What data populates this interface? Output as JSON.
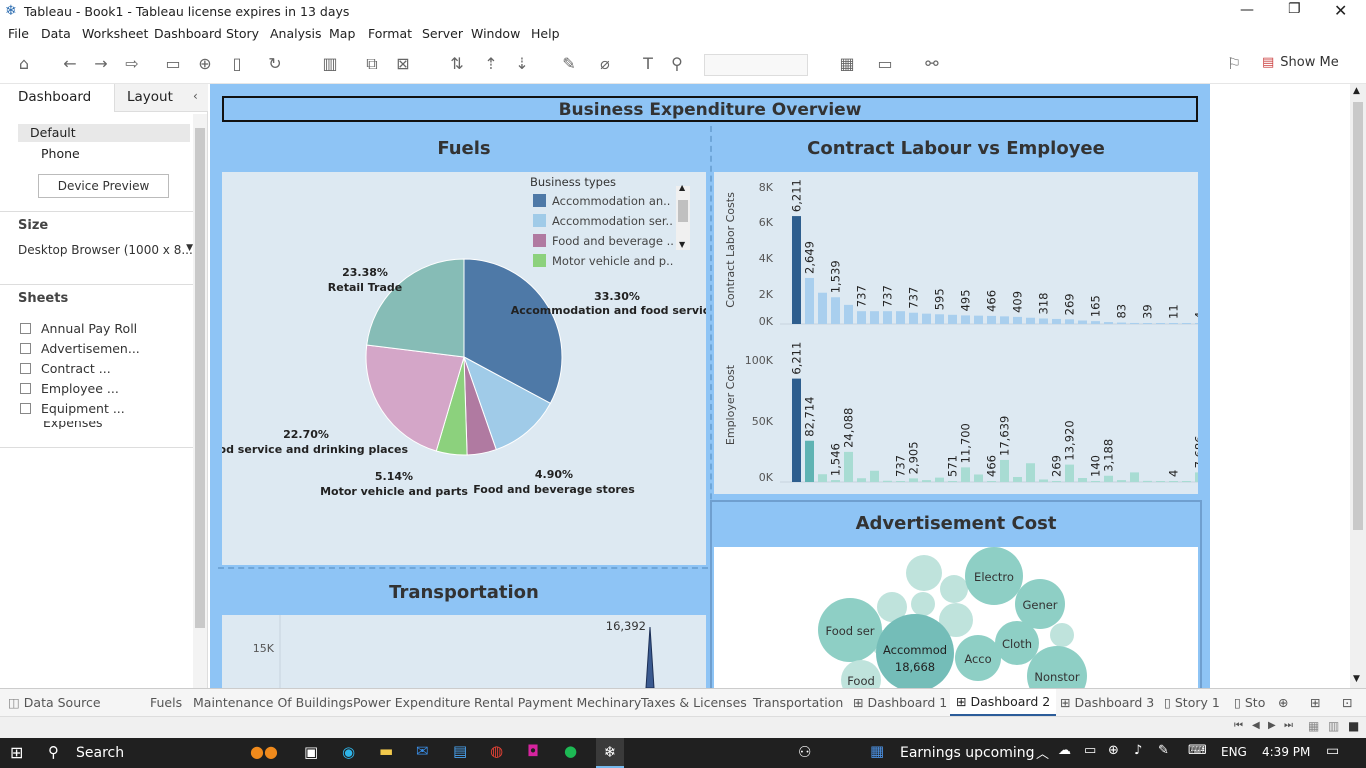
{
  "window": {
    "title": "Tableau - Book1 - Tableau license expires in 13 days"
  },
  "menu": [
    "File",
    "Data",
    "Worksheet",
    "Dashboard",
    "Story",
    "Analysis",
    "Map",
    "Format",
    "Server",
    "Window",
    "Help"
  ],
  "toolbar": {
    "show_me": "Show Me"
  },
  "left": {
    "tab_dashboard": "Dashboard",
    "tab_layout": "Layout",
    "device_default": "Default",
    "device_phone": "Phone",
    "device_preview": "Device Preview",
    "size_heading": "Size",
    "size_value": "Desktop Browser (1000 x 8...",
    "sheets_heading": "Sheets",
    "sheets": [
      "Annual Pay Roll",
      "Advertisemen...",
      "Contract ...",
      "Employee ...",
      "Equipment ...",
      "Expenses YoY"
    ]
  },
  "dashboard": {
    "title": "Business Expenditure Overview",
    "fuels": {
      "title": "Fuels",
      "legend_title": "Business types",
      "legend": [
        {
          "label": "Accommodation an..",
          "color": "#4e79a7"
        },
        {
          "label": "Accommodation ser..",
          "color": "#a0cbe8"
        },
        {
          "label": "Food and beverage ..",
          "color": "#b07aa1"
        },
        {
          "label": "Motor vehicle and p..",
          "color": "#8cd17d"
        }
      ],
      "slices": [
        {
          "pct": "33.30%",
          "label": "Accommodation and food services",
          "value": 33.3,
          "color": "#4e79a7"
        },
        {
          "pct": "",
          "label": "",
          "value": 12.0,
          "color": "#a0cbe8"
        },
        {
          "pct": "4.90%",
          "label": "Food and beverage stores",
          "value": 4.9,
          "color": "#b07aa1"
        },
        {
          "pct": "5.14%",
          "label": "Motor vehicle and parts",
          "value": 5.14,
          "color": "#8cd17d"
        },
        {
          "pct": "22.70%",
          "label": "Food service and drinking places",
          "value": 22.7,
          "color": "#d4a6c8"
        },
        {
          "pct": "23.38%",
          "label": "Retail Trade",
          "value": 23.38,
          "color": "#86bcb6"
        }
      ]
    },
    "contract": {
      "title": "Contract Labour vs Employee",
      "top_ylabel": "Contract Labor Costs",
      "top_ticks": [
        "8K",
        "6K",
        "4K",
        "2K",
        "0K"
      ],
      "top_values": [
        6211,
        2649,
        1800,
        1539,
        1100,
        737,
        737,
        737,
        737,
        650,
        595,
        560,
        530,
        495,
        480,
        466,
        440,
        409,
        360,
        318,
        290,
        269,
        200,
        165,
        110,
        83,
        60,
        39,
        25,
        11,
        8,
        4
      ],
      "top_labels": [
        [
          "6,211",
          0
        ],
        [
          "2,649",
          1
        ],
        [
          "1,539",
          3
        ],
        [
          "737",
          5
        ],
        [
          "737",
          7
        ],
        [
          "737",
          9
        ],
        [
          "595",
          11
        ],
        [
          "495",
          13
        ],
        [
          "466",
          15
        ],
        [
          "409",
          17
        ],
        [
          "318",
          19
        ],
        [
          "269",
          21
        ],
        [
          "165",
          23
        ],
        [
          "83",
          25
        ],
        [
          "39",
          27
        ],
        [
          "11",
          29
        ],
        [
          "4",
          31
        ]
      ],
      "bottom_ylabel": "Employer Cost",
      "bottom_ticks": [
        "100K",
        "50K",
        "0K"
      ],
      "bottom_values": [
        82714,
        33000,
        6211,
        1546,
        24088,
        3000,
        9000,
        1000,
        737,
        2905,
        1500,
        3500,
        571,
        11700,
        6000,
        466,
        17639,
        4000,
        15000,
        2000,
        269,
        13920,
        3188,
        140,
        5000,
        1500,
        7686,
        900,
        500,
        4,
        300,
        7686
      ],
      "bottom_labels": [
        [
          "6,211",
          0
        ],
        [
          "82,714",
          1
        ],
        [
          "1,546",
          3
        ],
        [
          "24,088",
          4
        ],
        [
          "737",
          8
        ],
        [
          "2,905",
          9
        ],
        [
          "571",
          12
        ],
        [
          "11,700",
          13
        ],
        [
          "466",
          15
        ],
        [
          "17,639",
          16
        ],
        [
          "269",
          20
        ],
        [
          "13,920",
          21
        ],
        [
          "140",
          23
        ],
        [
          "3,188",
          24
        ],
        [
          "4",
          29
        ],
        [
          "7,686",
          31
        ]
      ]
    },
    "transport": {
      "title": "Transportation",
      "tick": "15K",
      "peak_label": "16,392"
    },
    "advert": {
      "title": "Advertisement Cost",
      "bubbles": [
        {
          "label": "Electro",
          "sub": ""
        },
        {
          "label": "Gener",
          "sub": ""
        },
        {
          "label": "Food ser",
          "sub": ""
        },
        {
          "label": "Accommod",
          "sub": "18,668"
        },
        {
          "label": "Cloth",
          "sub": ""
        },
        {
          "label": "Acco",
          "sub": ""
        },
        {
          "label": "Nonstor",
          "sub": ""
        },
        {
          "label": "Food",
          "sub": ""
        }
      ]
    }
  },
  "tabs": [
    "Data Source",
    "Fuels",
    "Maintenance Of Buildings",
    "Power Expenditure",
    "Rental Payment Mechinary",
    "Taxes & Licenses",
    "Transportation",
    "Dashboard 1",
    "Dashboard 2",
    "Dashboard 3",
    "Story 1",
    "Sto"
  ],
  "taskbar": {
    "search": "Search",
    "news": "Earnings upcoming",
    "lang": "ENG",
    "time": "4:39 PM"
  }
}
